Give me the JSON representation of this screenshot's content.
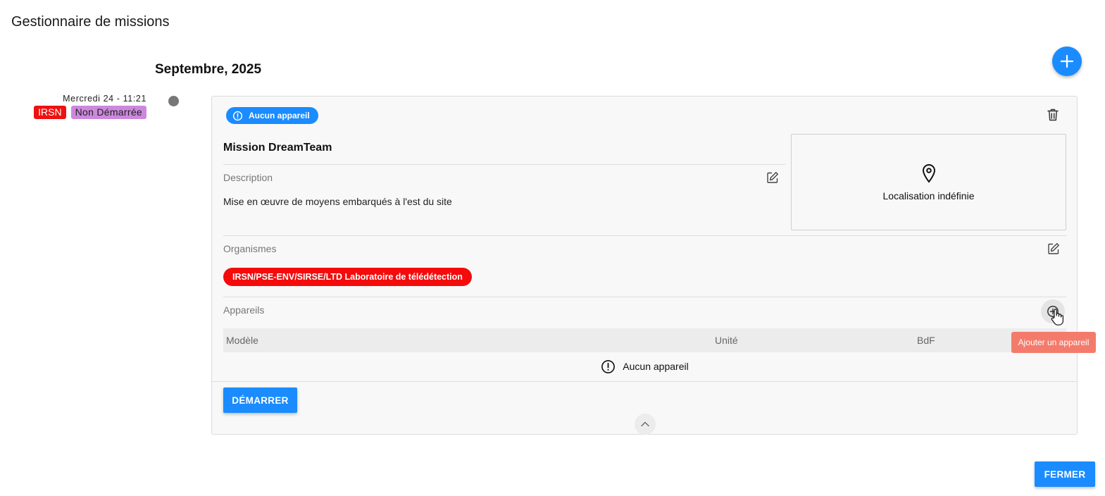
{
  "dialog": {
    "title": "Gestionnaire de missions",
    "close_label": "FERMER"
  },
  "timeline": {
    "month_label": "Septembre, 2025"
  },
  "fab": {
    "icon": "plus-icon",
    "color": "#1a8cff"
  },
  "mission": {
    "date_label": "Mercredi 24 - 11:21",
    "org_tag": "IRSN",
    "status_tag": "Non Démarrée",
    "device_badge": "Aucun appareil",
    "name": "Mission DreamTeam",
    "description_label": "Description",
    "description_text": "Mise en œuvre de moyens embarqués à l'est du site",
    "location_text": "Localisation indéfinie",
    "organisms_label": "Organismes",
    "organisms": [
      "IRSN/PSE-ENV/SIRSE/LTD Laboratoire de télédétection"
    ],
    "devices_label": "Appareils",
    "devices_table": {
      "columns": [
        "Modèle",
        "Unité",
        "BdF"
      ],
      "empty_text": "Aucun appareil"
    },
    "start_label": "DÉMARRER",
    "add_device_tooltip": "Ajouter un appareil"
  },
  "colors": {
    "primary": "#1a8cff",
    "irsn_red": "#ee1111",
    "status_purple": "#cc88dd",
    "tooltip": "#f47b6b"
  }
}
